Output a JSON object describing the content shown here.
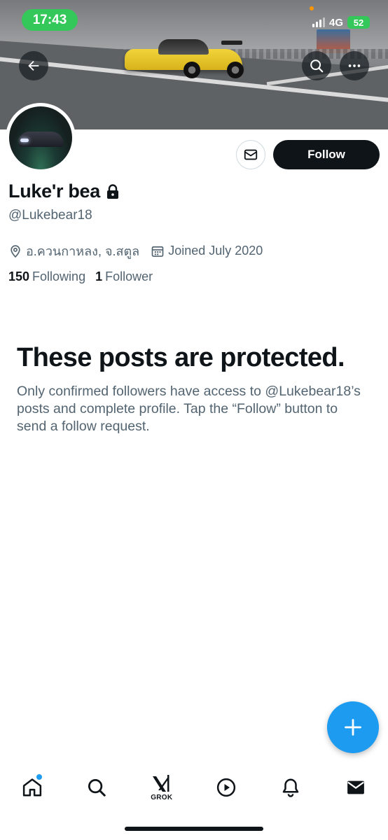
{
  "status_bar": {
    "time": "17:43",
    "network": "4G",
    "battery": "52"
  },
  "profile": {
    "display_name": "Luke'r bea",
    "handle": "@Lukebear18",
    "location": "อ.ควนกาหลง, จ.สตูล",
    "joined": "Joined July 2020",
    "following_count": "150",
    "following_label": "Following",
    "followers_count": "1",
    "followers_label": "Follower",
    "locked": true
  },
  "actions": {
    "follow_label": "Follow"
  },
  "protected": {
    "title": "These posts are protected.",
    "body": "Only confirmed followers have access to @Lukebear18’s posts and complete profile. Tap the “Follow” button to send a follow request."
  },
  "bottom_nav": {
    "items": [
      {
        "name": "home",
        "active": true,
        "has_notification_dot": true
      },
      {
        "name": "search"
      },
      {
        "name": "grok",
        "label": "GROK"
      },
      {
        "name": "video"
      },
      {
        "name": "notifications"
      },
      {
        "name": "messages"
      }
    ]
  },
  "colors": {
    "accent": "#1d9bf0",
    "text_primary": "#0f1419",
    "text_secondary": "#536471",
    "status_green": "#34c759"
  }
}
